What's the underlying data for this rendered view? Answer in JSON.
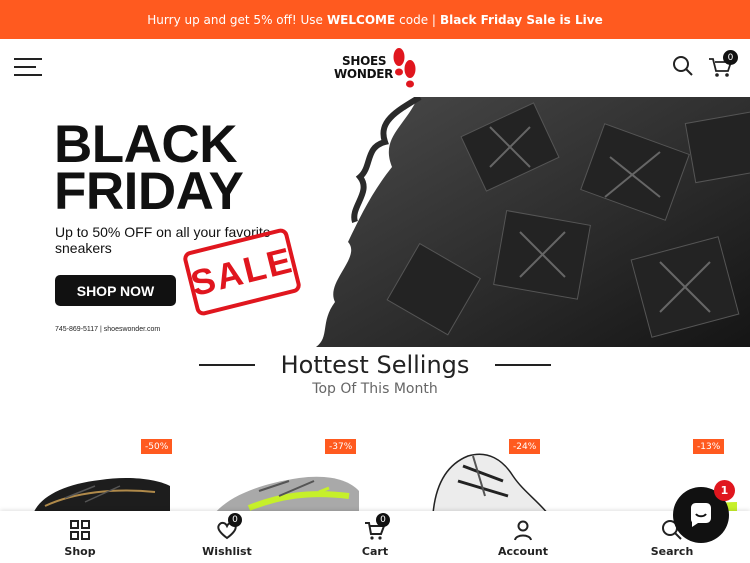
{
  "announcement": {
    "prefix": "Hurry up and get 5% off! Use",
    "code": "WELCOME",
    "middle": "code |",
    "highlight": "Black Friday Sale is Live"
  },
  "header": {
    "logo_line1": "SHOES",
    "logo_line2": "WONDER",
    "cart_count": "0"
  },
  "hero": {
    "title_line1": "BLACK",
    "title_line2": "FRIDAY",
    "subtitle": "Up to 50% OFF on all your favorite sneakers",
    "cta": "SHOP NOW",
    "sale_text": "SALE",
    "contact": "745-869-5117 | shoeswonder.com"
  },
  "section": {
    "title": "Hottest Sellings",
    "subtitle": "Top Of This Month"
  },
  "products": [
    {
      "discount": "-50%"
    },
    {
      "discount": "-37%"
    },
    {
      "discount": "-24%"
    },
    {
      "discount": "-13%"
    }
  ],
  "bottom_nav": {
    "shop": "Shop",
    "wishlist": "Wishlist",
    "wishlist_count": "0",
    "cart": "Cart",
    "cart_count": "0",
    "account": "Account",
    "search": "Search"
  },
  "chat": {
    "badge": "1"
  },
  "colors": {
    "accent": "#ff5a1f",
    "sale_red": "#e0161e",
    "dark": "#111111"
  }
}
